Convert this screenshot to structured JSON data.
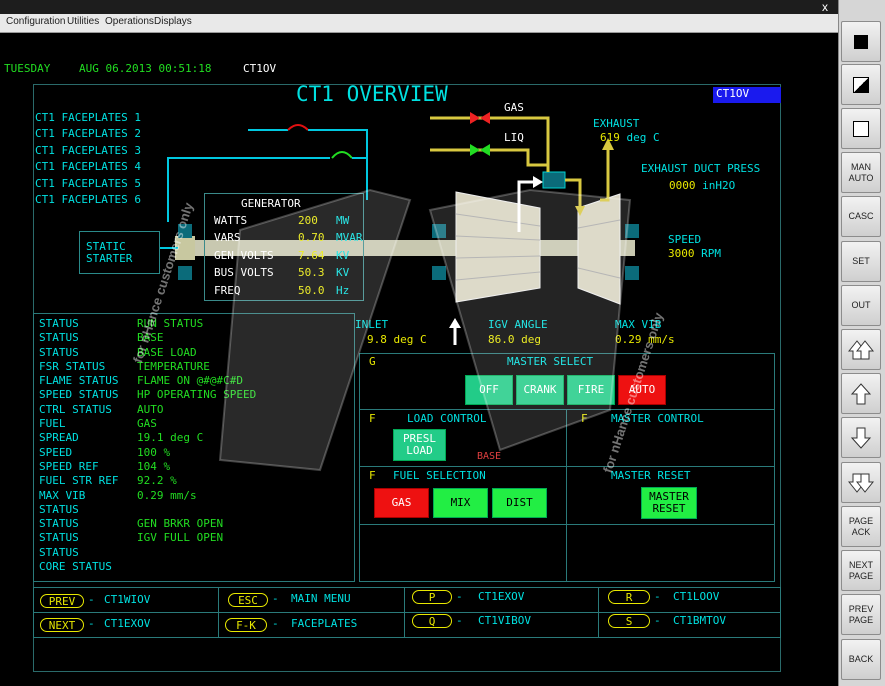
{
  "menu": [
    "Configuration",
    "Utilities",
    "Operations",
    "Displays"
  ],
  "window_close": "x",
  "header": {
    "day": "TUESDAY",
    "datetime": "AUG 06.2013 00:51:18",
    "unit": "CT1OV"
  },
  "title": "CT1 OVERVIEW",
  "unit_badge": "CT1OV",
  "faceplates": [
    "CT1 FACEPLATES 1",
    "CT1 FACEPLATES 2",
    "CT1 FACEPLATES 3",
    "CT1 FACEPLATES 4",
    "CT1 FACEPLATES 5",
    "CT1 FACEPLATES 6"
  ],
  "static_starter": "STATIC\nSTARTER",
  "generator": {
    "title": "GENERATOR",
    "rows": [
      {
        "label": "WATTS",
        "value": "200",
        "unit": "MW"
      },
      {
        "label": "VARS",
        "value": "0.70",
        "unit": "MVAR"
      },
      {
        "label": "GEN VOLTS",
        "value": "7.64",
        "unit": "KV"
      },
      {
        "label": "BUS VOLTS",
        "value": "50.3",
        "unit": "KV"
      },
      {
        "label": "FREQ",
        "value": "50.0",
        "unit": "Hz"
      }
    ]
  },
  "fuel_lines": {
    "gas": "GAS",
    "liq": "LIQ"
  },
  "exhaust": {
    "label": "EXHAUST",
    "value": "619",
    "unit": "deg C"
  },
  "exhaust_duct": {
    "label": "EXHAUST DUCT PRESS",
    "value": "0000",
    "unit": "inH2O"
  },
  "speed": {
    "label": "SPEED",
    "value": "3000",
    "unit": "RPM"
  },
  "inlet": {
    "label": "INLET",
    "value": "9.8 deg C"
  },
  "igv": {
    "label": "IGV ANGLE",
    "value": "86.0 deg"
  },
  "max_vib": {
    "label": "MAX VIB",
    "value": "0.29 mm/s"
  },
  "status_rows": [
    {
      "label": "STATUS",
      "value": "RUN STATUS"
    },
    {
      "label": "STATUS",
      "value": "BASE"
    },
    {
      "label": "STATUS",
      "value": "BASE LOAD"
    },
    {
      "label": "FSR STATUS",
      "value": "TEMPERATURE"
    },
    {
      "label": "FLAME STATUS",
      "value": "FLAME ON @#@#C#D"
    },
    {
      "label": "SPEED STATUS",
      "value": "HP OPERATING SPEED"
    },
    {
      "label": "CTRL STATUS",
      "value": "AUTO"
    },
    {
      "label": "FUEL",
      "value": "GAS"
    },
    {
      "label": "SPREAD",
      "value": "19.1 deg C"
    },
    {
      "label": "SPEED",
      "value": "100 %"
    },
    {
      "label": "SPEED REF",
      "value": "104 %"
    },
    {
      "label": "FUEL STR REF",
      "value": "92.2 %"
    },
    {
      "label": "MAX VIB",
      "value": "0.29 mm/s"
    },
    {
      "label": "STATUS",
      "value": ""
    },
    {
      "label": "STATUS",
      "value": "GEN BRKR OPEN"
    },
    {
      "label": "STATUS",
      "value": "IGV FULL OPEN"
    },
    {
      "label": "STATUS",
      "value": ""
    },
    {
      "label": "CORE STATUS",
      "value": ""
    }
  ],
  "master_select": {
    "flag": "G",
    "title": "MASTER SELECT",
    "buttons": [
      "OFF",
      "CRANK",
      "FIRE",
      "AUTO"
    ]
  },
  "load_control": {
    "flag": "F",
    "title": "LOAD CONTROL",
    "button": "PRESL\nLOAD",
    "status": "BASE"
  },
  "master_control": {
    "flag": "F",
    "title": "MASTER CONTROL"
  },
  "fuel_selection": {
    "flag": "F",
    "title": "FUEL SELECTION",
    "buttons": [
      "GAS",
      "MIX",
      "DIST"
    ]
  },
  "master_reset": {
    "title": "MASTER RESET",
    "button": "MASTER\nRESET"
  },
  "nav": [
    {
      "key": "PREV",
      "target": "CT1WIOV"
    },
    {
      "key": "ESC",
      "target": "MAIN MENU"
    },
    {
      "key": "P",
      "target": "CT1EXOV"
    },
    {
      "key": "R",
      "target": "CT1LOOV"
    },
    {
      "key": "NEXT",
      "target": "CT1EXOV"
    },
    {
      "key": "F-K",
      "target": "FACEPLATES"
    },
    {
      "key": "Q",
      "target": "CT1VIBOV"
    },
    {
      "key": "S",
      "target": "CT1BMTOV"
    }
  ],
  "right_buttons": [
    "MAN\nAUTO",
    "CASC",
    "SET",
    "OUT",
    "PAGE\nACK",
    "NEXT\nPAGE",
    "PREV\nPAGE",
    "BACK"
  ],
  "watermark": "for nHance customers only",
  "colors": {
    "cyan": "#00e0e0",
    "green": "#22dd22",
    "yellow": "#e8e800",
    "red_button": "#ee1111",
    "green_button": "#22dd55"
  }
}
